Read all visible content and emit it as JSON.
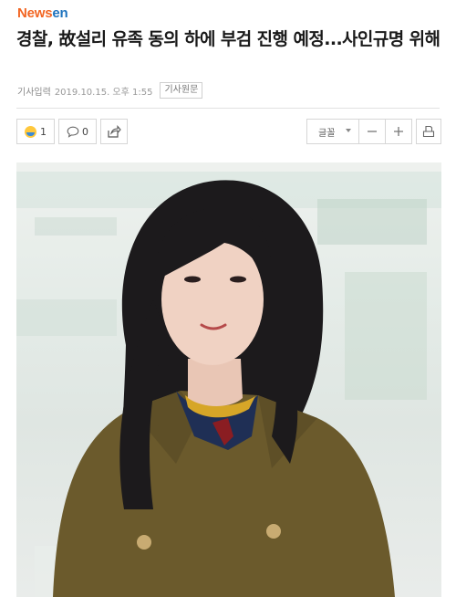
{
  "site": {
    "logo_part1": "News",
    "logo_part2": "en"
  },
  "article": {
    "title": "경찰, 故설리 유족 동의 하에 부검 진행 예정...사인규명 위해",
    "meta_label": "기사입력",
    "datetime": "2019.10.15. 오후 1:55",
    "origin_label": "기사원문"
  },
  "toolbar": {
    "reaction_count": "1",
    "comment_count": "0",
    "font_label": "글꼴",
    "font_decrease_icon": "minus-icon",
    "font_increase_icon": "plus-icon",
    "print_icon": "print-icon",
    "share_icon": "share-icon",
    "comment_icon": "speech-bubble-icon",
    "reaction_icon": "emoji-face-icon"
  },
  "colors": {
    "logo_orange": "#f26522",
    "logo_blue": "#1e73be",
    "coat": "#6b5a2c"
  }
}
